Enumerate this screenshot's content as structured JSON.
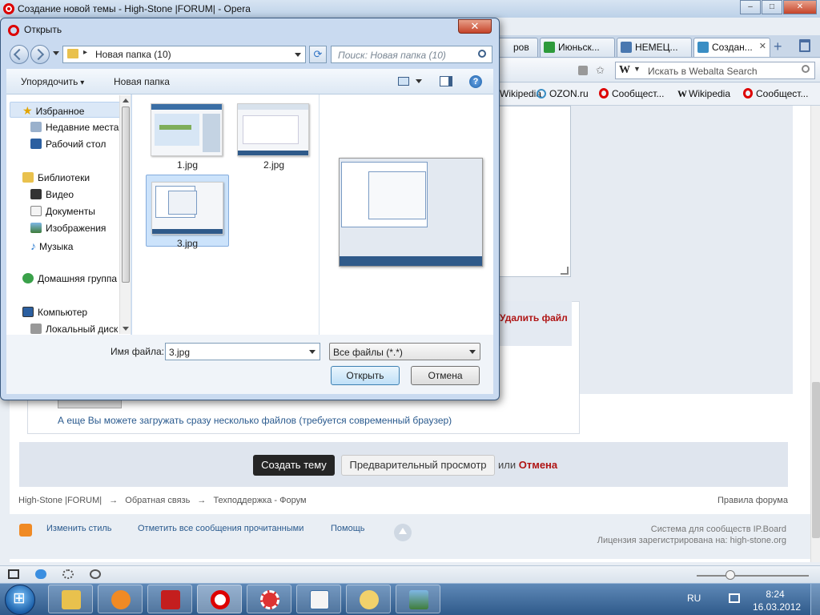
{
  "browser": {
    "window_title": "Создание новой темы - High-Stone |FORUM| - Opera",
    "tabs": [
      {
        "label": "ров",
        "icon_color": "#3a6ea5"
      },
      {
        "label": "Июньск...",
        "icon_color": "#2e9a3b"
      },
      {
        "label": "НЕМЕЦ...",
        "icon_color": "#4a78b0"
      },
      {
        "label": "Создан...",
        "icon_color": "#3a8ec4",
        "active": true
      }
    ],
    "search_placeholder": "Искать в Webalta Search",
    "search_engine_letter": "W",
    "bookmarks": [
      {
        "label": "Wikipedia",
        "kind": "partial"
      },
      {
        "label": "OZON.ru",
        "kind": "ozon"
      },
      {
        "label": "Сообщест...",
        "kind": "opera"
      },
      {
        "label": "Wikipedia",
        "kind": "wiki"
      },
      {
        "label": "Сообщест...",
        "kind": "opera"
      }
    ]
  },
  "page": {
    "delete_file": "Удалить файл",
    "multi_upload": "А еще Вы можете загружать сразу несколько файлов (требуется современный браузер)",
    "create_topic": "Создать тему",
    "preview": "Предварительный просмотр",
    "or": "или",
    "cancel": "Отмена",
    "breadcrumb": [
      "High-Stone |FORUM|",
      "→",
      "Обратная связь",
      "→",
      "Техподдержка - Форум"
    ],
    "rules": "Правила форума",
    "footer_links": [
      "Изменить стиль",
      "Отметить все сообщения прочитанными",
      "Помощь"
    ],
    "powered_1": "Система для сообществ IP.Board",
    "powered_2": "Лицензия зарегистрирована на: high-stone.org"
  },
  "dialog": {
    "title": "Открыть",
    "path": "Новая папка (10)",
    "search_placeholder": "Поиск: Новая папка (10)",
    "organize": "Упорядочить",
    "new_folder": "Новая папка",
    "nav": {
      "favorites": "Избранное",
      "recent": "Недавние места",
      "desktop": "Рабочий стол",
      "libraries": "Библиотеки",
      "video": "Видео",
      "documents": "Документы",
      "images": "Изображения",
      "music": "Музыка",
      "homegroup": "Домашняя группа",
      "computer": "Компьютер",
      "local_disk": "Локальный диск"
    },
    "files": [
      {
        "name": "1.jpg"
      },
      {
        "name": "2.jpg"
      },
      {
        "name": "3.jpg",
        "selected": true
      }
    ],
    "filename_label": "Имя файла:",
    "filename_value": "3.jpg",
    "filetype": "Все файлы (*.*)",
    "open": "Открыть",
    "cancel": "Отмена"
  },
  "taskbar": {
    "language": "RU",
    "time": "8:24",
    "date": "16.03.2012"
  },
  "colors": {
    "accent_red": "#b01515",
    "link_blue": "#2a5a8e",
    "taskbar": "#2f5a8a"
  }
}
